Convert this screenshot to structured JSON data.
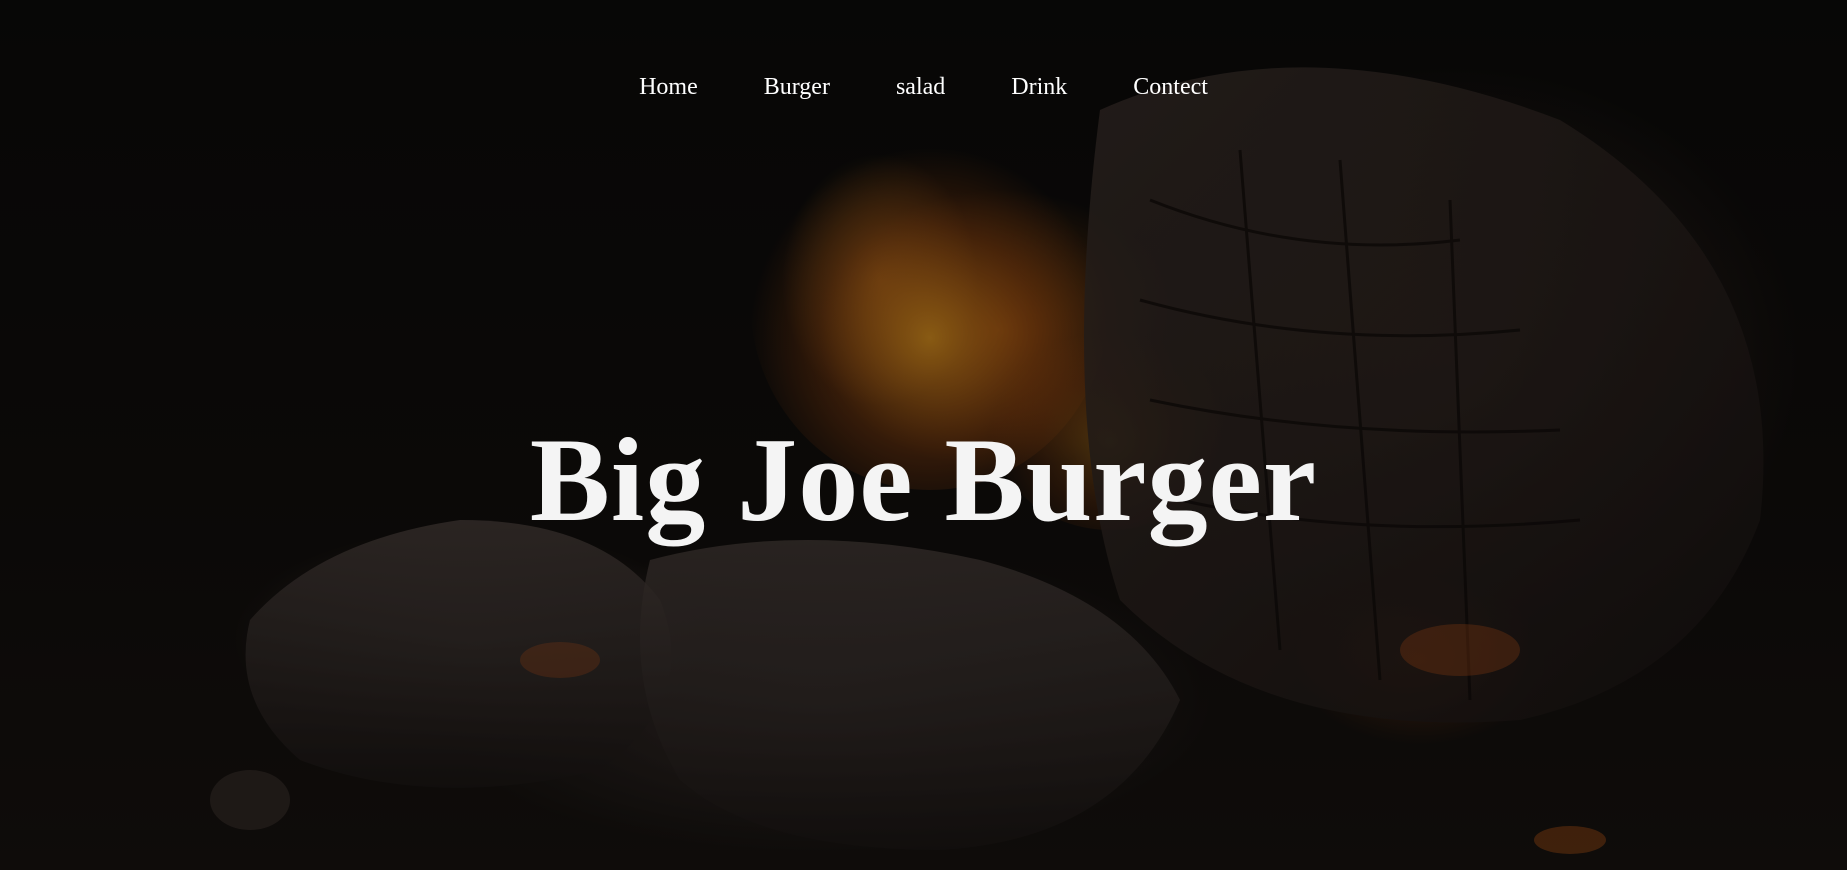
{
  "nav": {
    "items": [
      {
        "label": "Home"
      },
      {
        "label": "Burger"
      },
      {
        "label": "salad"
      },
      {
        "label": "Drink"
      },
      {
        "label": "Contect"
      }
    ]
  },
  "hero": {
    "title": "Big Joe Burger",
    "background_image": "campfire-embers-image"
  },
  "colors": {
    "text": "#ffffff",
    "background": "#0b0a09",
    "ember": "#d66e14"
  }
}
